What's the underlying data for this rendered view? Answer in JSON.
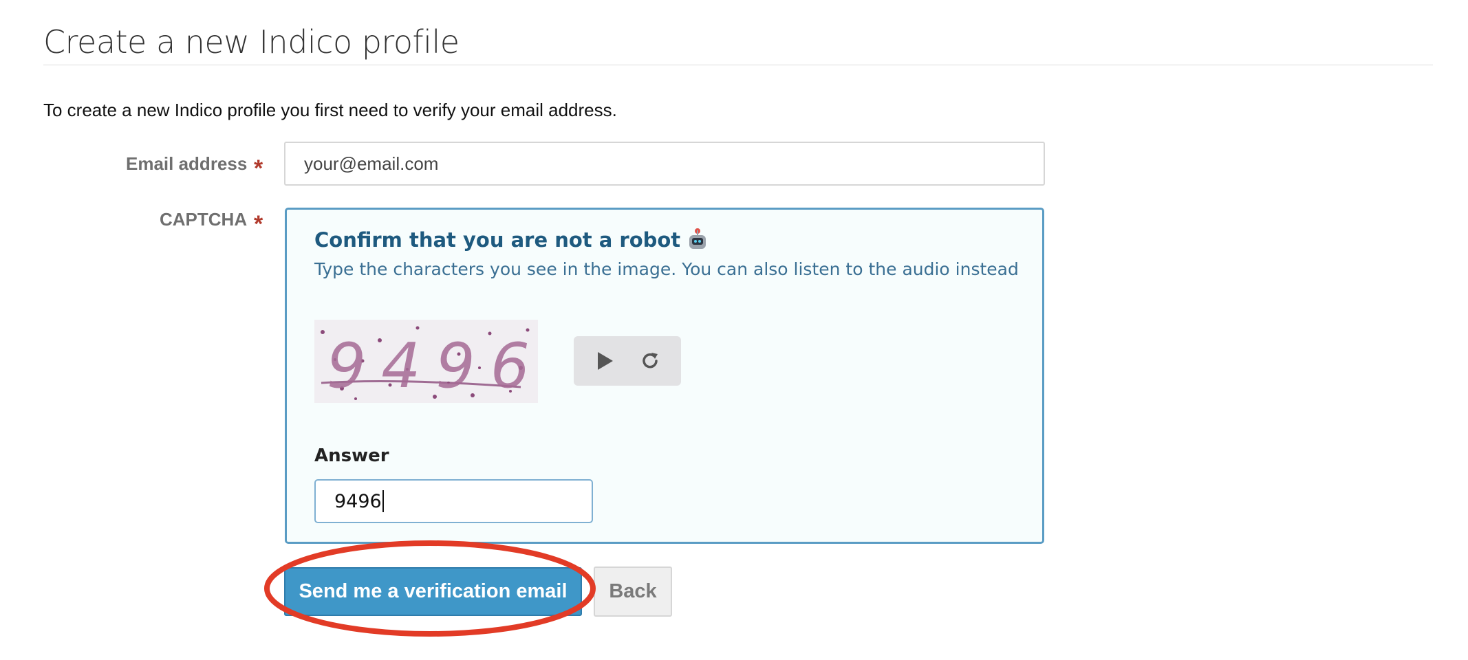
{
  "page": {
    "title": "Create a new Indico profile",
    "intro": "To create a new Indico profile you first need to verify your email address."
  },
  "form": {
    "email": {
      "label": "Email address",
      "required_mark": "*",
      "value": "your@email.com"
    },
    "captcha": {
      "label": "CAPTCHA",
      "required_mark": "*",
      "heading": "Confirm that you are not a robot",
      "heading_icon": "robot-icon",
      "instructions": "Type the characters you see in the image. You can also listen to the audio instead",
      "image_text": "9496",
      "audio_icon": "play-icon",
      "reload_icon": "reload-icon",
      "answer_label": "Answer",
      "answer_value": "9496"
    }
  },
  "actions": {
    "send_label": "Send me a verification email",
    "back_label": "Back"
  },
  "colors": {
    "primary": "#3f97c8",
    "captcha_border": "#5a9cc4",
    "captcha_heading": "#1e5a7f",
    "required": "#b13a2c",
    "annotation": "#e23b26"
  }
}
